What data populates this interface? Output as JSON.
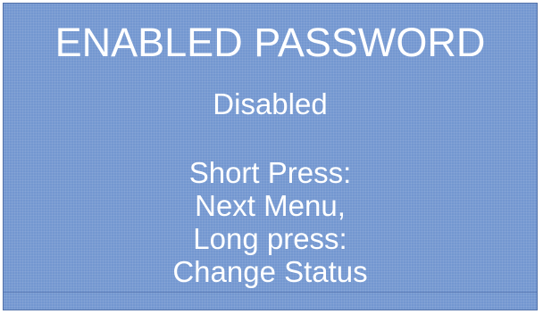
{
  "screen": {
    "title": "ENABLED PASSWORD",
    "status": "Disabled",
    "hint_lines": [
      "Short Press:",
      "Next Menu,",
      "Long press:",
      "Change Status"
    ]
  },
  "colors": {
    "background": "#7397d0",
    "text": "#ffffff"
  }
}
